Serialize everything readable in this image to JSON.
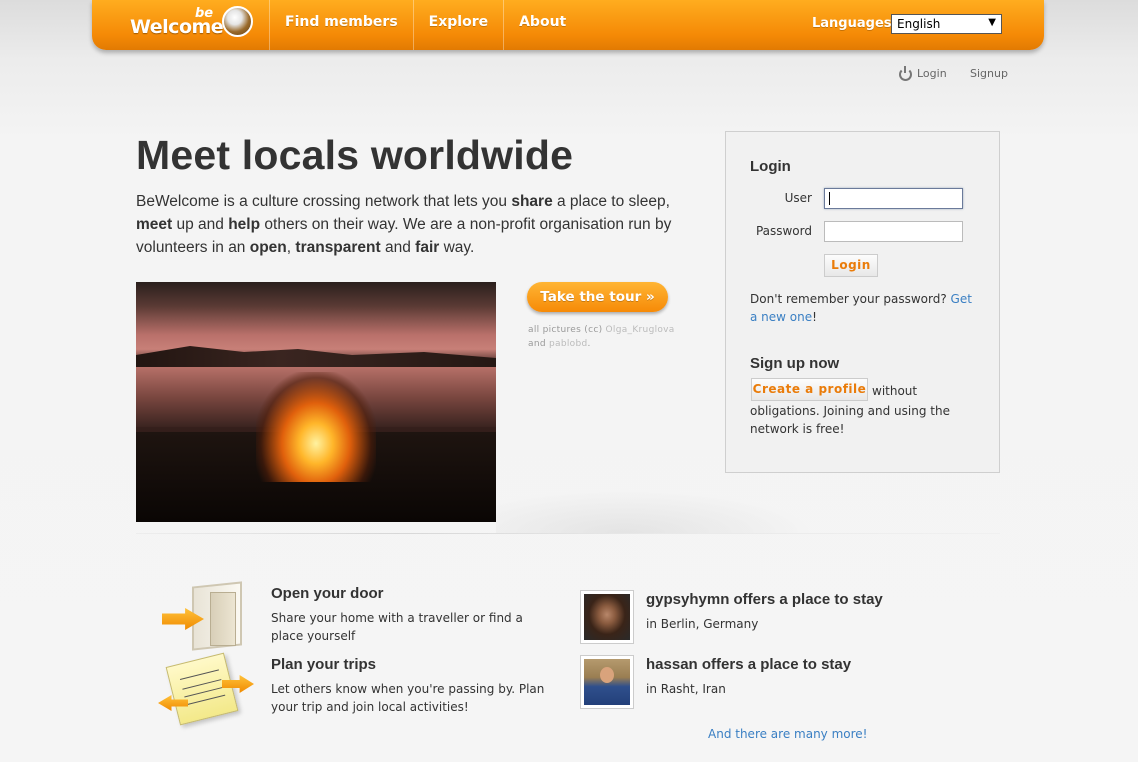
{
  "header": {
    "logo_be": "be",
    "logo_welcome": "Welcome",
    "nav": [
      "Find members",
      "Explore",
      "About"
    ],
    "languages_label": "Languages:",
    "language_selected": "English"
  },
  "toplinks": {
    "login": "Login",
    "signup": "Signup"
  },
  "hero": {
    "title": "Meet locals worldwide",
    "text_parts": {
      "p1": "BeWelcome is a culture crossing network that lets you ",
      "b1": "share",
      "p2": " a place to sleep, ",
      "b2": "meet",
      "p3": " up and ",
      "b3": "help",
      "p4": " others on their way. We are a non-profit organisation run by volunteers in an ",
      "b4": "open",
      "p5": ", ",
      "b5": "transparent",
      "p6": " and ",
      "b6": "fair",
      "p7": " way."
    },
    "tour_button": "Take the tour »",
    "credits": {
      "prefix": "all pictures (cc) ",
      "author1": "Olga_Kruglova",
      "and": "and ",
      "author2": "pablobd",
      "dot": "."
    }
  },
  "login_panel": {
    "heading": "Login",
    "user_label": "User",
    "password_label": "Password",
    "login_button": "Login",
    "forgot_text": "Don't remember your password? ",
    "forgot_link": "Get a new one",
    "forgot_end": "!",
    "signup_heading": "Sign up now",
    "create_button": "Create a profile",
    "signup_text_1": "without",
    "signup_text_2": "obligations. Joining and using the network is free!"
  },
  "features": [
    {
      "title": "Open your door",
      "text": "Share your home with a traveller or find a place yourself"
    },
    {
      "title": "Plan your trips",
      "text": "Let others know when you're passing by. Plan your trip and join local activities!"
    }
  ],
  "hosts": [
    {
      "title": "gypsyhymn offers a place to stay",
      "location": "in Berlin, Germany"
    },
    {
      "title": "hassan offers a place to stay",
      "location": "in Rasht, Iran"
    }
  ],
  "more_link": "And there are many more!",
  "colors": {
    "accent": "#f58a06",
    "link": "#3a7fc3",
    "button_text": "#ea7c0a"
  }
}
